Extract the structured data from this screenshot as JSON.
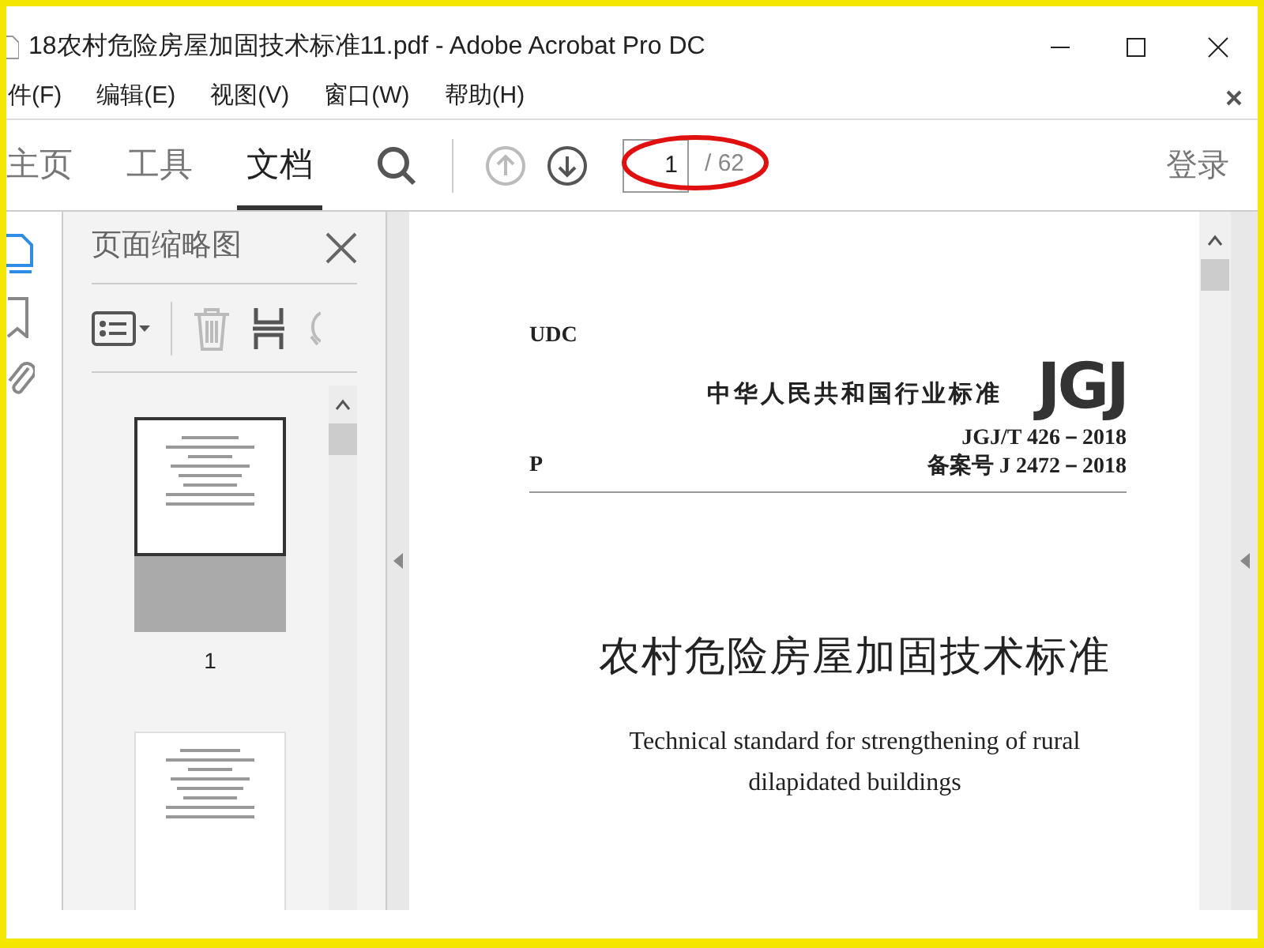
{
  "window": {
    "title": "18农村危险房屋加固技术标准11.pdf - Adobe Acrobat Pro DC"
  },
  "menu": [
    "件(F)",
    "编辑(E)",
    "视图(V)",
    "窗口(W)",
    "帮助(H)"
  ],
  "tabs": [
    {
      "label": "主页",
      "selected": false
    },
    {
      "label": "工具",
      "selected": false
    },
    {
      "label": "文档",
      "selected": true
    }
  ],
  "page_nav": {
    "value": "1",
    "total": "/ 62"
  },
  "sign_in": "登录",
  "side_panel": {
    "title": "页面缩略图",
    "thumbnails": [
      {
        "label": "1",
        "selected": true
      },
      {
        "selected": false
      }
    ]
  },
  "document": {
    "udc": "UDC",
    "industry": "中华人民共和国行业标准",
    "logo": "JGJ",
    "p": "P",
    "code": "JGJ/T 426－2018",
    "record": "备案号 J 2472－2018",
    "title": "农村危险房屋加固技术标准",
    "english_title": "Technical standard for strengthening of rural dilapidated buildings"
  }
}
